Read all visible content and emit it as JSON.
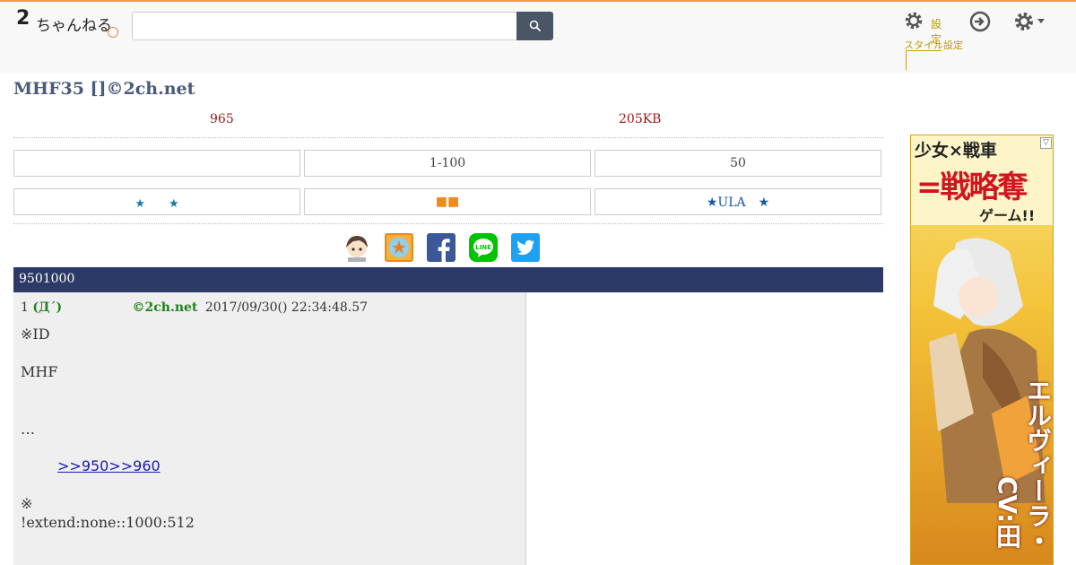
{
  "header": {
    "logo_text": "2",
    "logo_sub": "ちゃんねる",
    "search_placeholder": "",
    "search_value": "",
    "settings_label_short": "設定",
    "settings_label_long": "スタイル設定",
    "icons": [
      "search-icon",
      "gear-icon",
      "login-icon",
      "gear-menu-icon"
    ]
  },
  "thread": {
    "title": "MHF35 []©2ch.net",
    "post_count": "965",
    "size": "205KB",
    "bar_text": "9501000"
  },
  "nav": {
    "row1": [
      "",
      "1-100",
      "50"
    ],
    "row2": [
      "★　　★",
      "■■",
      "★ULA　★"
    ]
  },
  "share": [
    "avatar-icon",
    "bookmark-icon",
    "facebook-icon",
    "line-icon",
    "twitter-icon"
  ],
  "post": {
    "number": "1",
    "name": "(Д´)",
    "signature": "©2ch.net",
    "date": "2017/09/30() 22:34:48.57",
    "lines": [
      "※ID",
      "MHF",
      "…",
      ">>950>>960",
      "※",
      "!extend:none::1000:512"
    ]
  },
  "ad": {
    "line1": "少女×戦車",
    "line2": "=戦略奪",
    "line3": "ゲーム!!",
    "vertical1": "エルヴィーラ・",
    "vertical2": "CV:田",
    "close": "▽"
  },
  "colors": {
    "accent": "#2b3a66",
    "count_red": "#a01818",
    "name_green": "#208020",
    "settings_gold": "#c8a000"
  }
}
